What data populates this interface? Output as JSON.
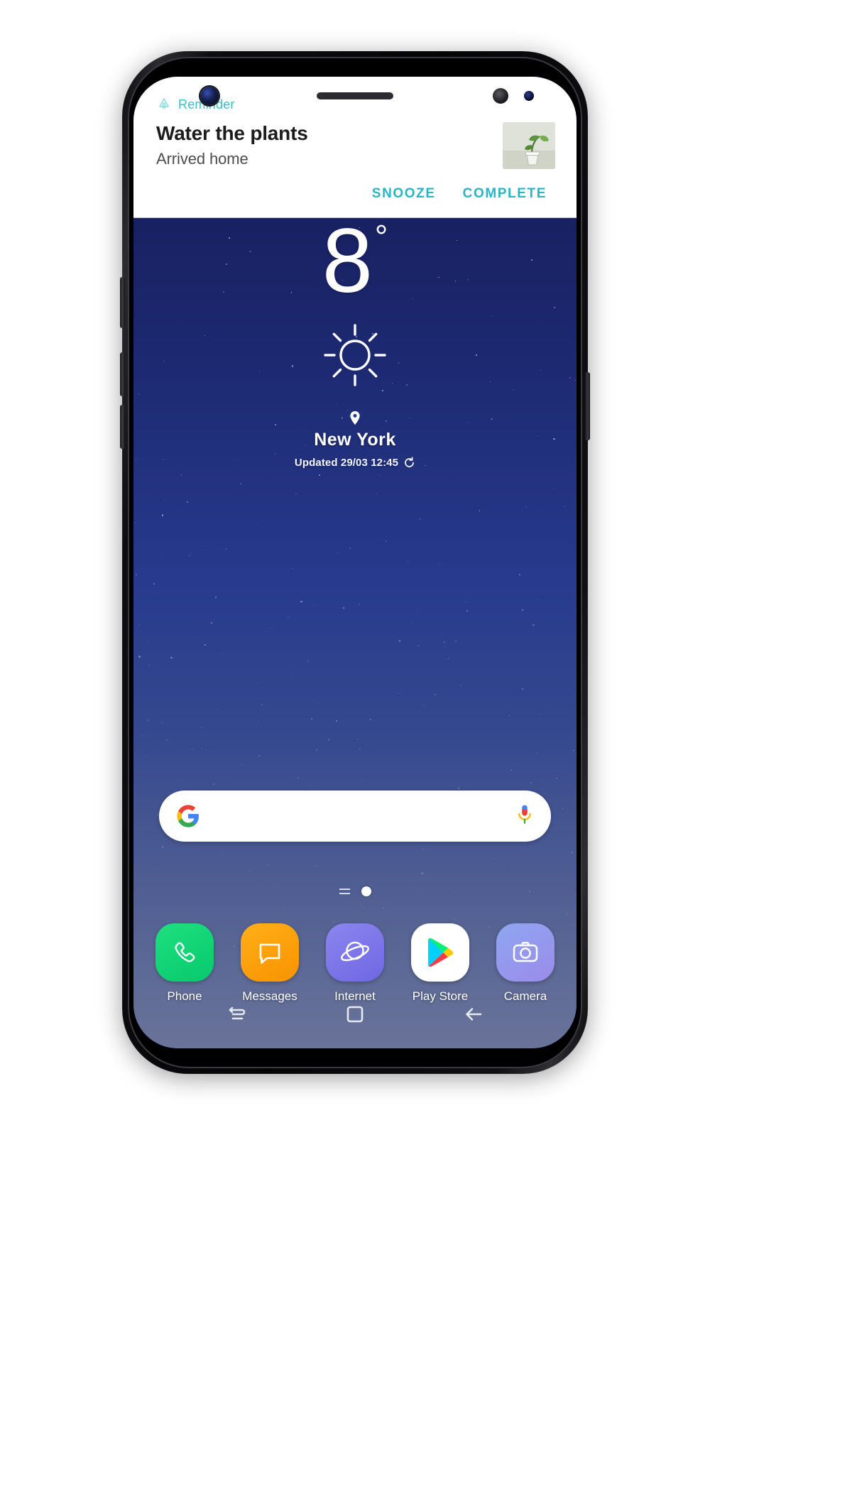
{
  "device": {
    "name": "Samsung Galaxy S8",
    "sensors": {
      "front_camera": "front-camera-icon",
      "earpiece": "earpiece-speaker",
      "iris_scanner": "iris-scanner-icon",
      "proximity_sensor": "proximity-sensor-icon"
    },
    "hardware_buttons": [
      "bixby-button",
      "volume-down-button",
      "volume-up-button",
      "power-button"
    ]
  },
  "notification": {
    "app_name": "Reminder",
    "app_icon": "reminder-bell-icon",
    "app_name_color": "#36bfc9",
    "title": "Water the plants",
    "subtitle": "Arrived home",
    "thumbnail": "potted-plant-photo",
    "actions": [
      {
        "label": "SNOOZE",
        "name": "snooze-button"
      },
      {
        "label": "COMPLETE",
        "name": "complete-button"
      }
    ],
    "action_color": "#2ab4c6"
  },
  "weather": {
    "temperature": "8",
    "degree_symbol": "°",
    "condition_icon": "sun-clear-icon",
    "condition": "Clear",
    "location_icon": "location-pin-icon",
    "city": "New York",
    "updated_text": "Updated 29/03 12:45",
    "refresh_icon": "refresh-icon"
  },
  "search": {
    "logo": "google-g-icon",
    "value": "",
    "placeholder": "",
    "mic_icon": "voice-mic-icon"
  },
  "page_indicator": {
    "app_list_icon": "app-list-lines-icon",
    "home_icon": "home-page-dot-icon"
  },
  "dock": {
    "apps": [
      {
        "label": "Phone",
        "icon": "phone-handset-icon",
        "color": "#0ad07a"
      },
      {
        "label": "Messages",
        "icon": "message-bubble-icon",
        "color": "#fba60c"
      },
      {
        "label": "Internet",
        "icon": "planet-orbit-icon",
        "color": "#7c74e8"
      },
      {
        "label": "Play Store",
        "icon": "play-store-icon",
        "color": "#ffffff"
      },
      {
        "label": "Camera",
        "icon": "camera-icon",
        "color": "#95a0ee"
      }
    ]
  },
  "nav_bar": {
    "buttons": [
      {
        "label": "Recents",
        "icon": "recents-icon"
      },
      {
        "label": "Home",
        "icon": "home-square-icon"
      },
      {
        "label": "Back",
        "icon": "back-arrow-icon"
      }
    ]
  },
  "wallpaper": {
    "description": "Night sky gradient with stars",
    "top_color": "#121a56",
    "bottom_color": "#6a7399"
  }
}
